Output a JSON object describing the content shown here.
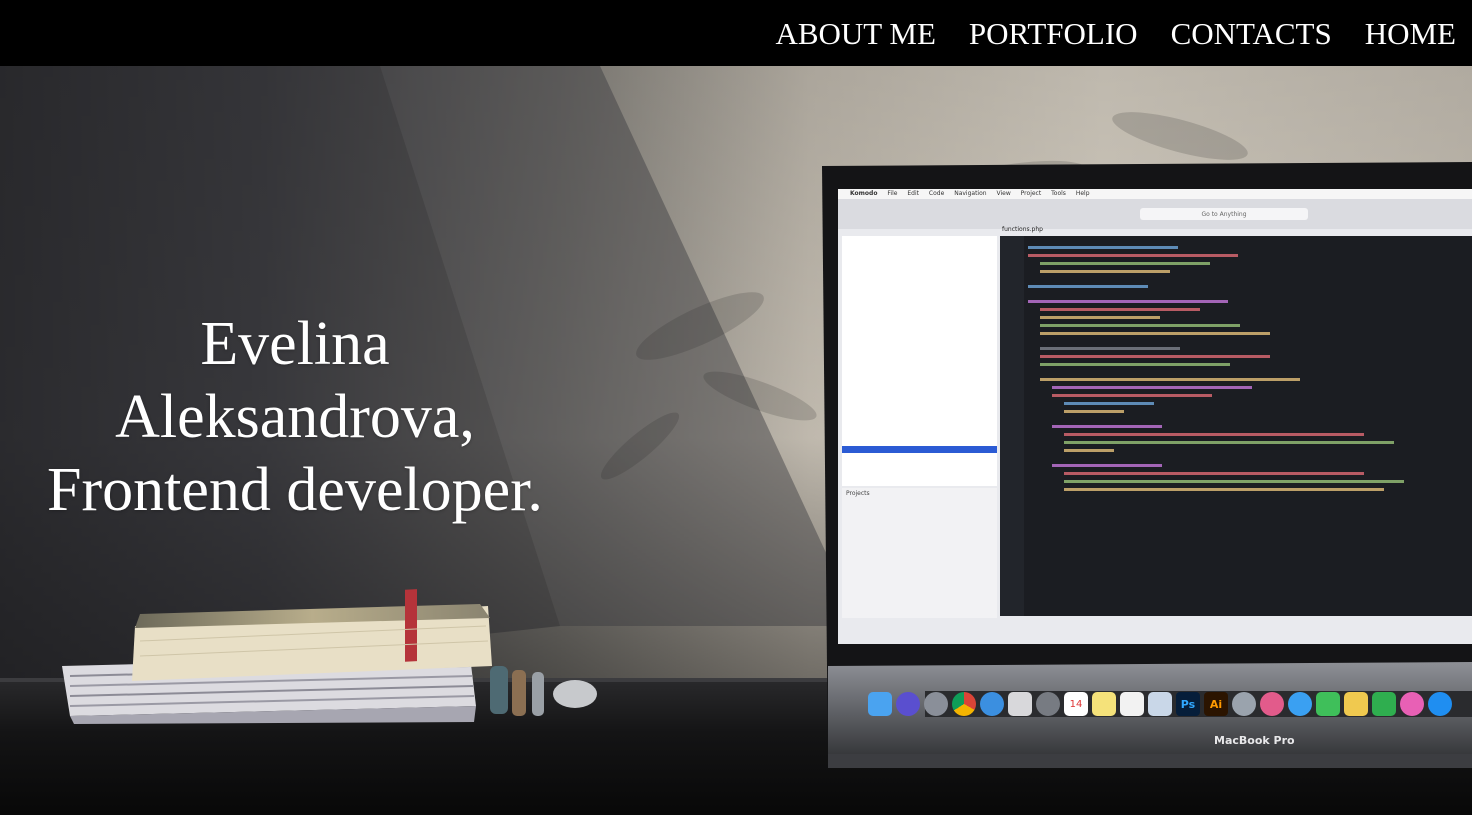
{
  "nav": {
    "items": [
      {
        "label": "ABOUT ME"
      },
      {
        "label": "PORTFOLIO"
      },
      {
        "label": "CONTACTS"
      },
      {
        "label": "HOME"
      }
    ]
  },
  "hero": {
    "title_lines": [
      "Evelina",
      "Aleksandrova,",
      "Frontend developer."
    ]
  },
  "laptop": {
    "brand_label": "MacBook Pro",
    "editor_menu": [
      "Komodo",
      "File",
      "Edit",
      "Code",
      "Navigation",
      "View",
      "Project",
      "Tools",
      "Help"
    ],
    "search_placeholder": "Go to Anything",
    "tab_label": "functions.php",
    "projects_label": "Projects",
    "dock_badge_ps": "Ps",
    "dock_badge_ai": "Ai",
    "dock_badge_cal": "14"
  },
  "colors": {
    "nav_bg": "#000000",
    "nav_text": "#ffffff",
    "hero_text": "#ffffff",
    "wall_light": "#d9d2c6",
    "wall_dark": "#3b3b3e",
    "desk": "#1c1c1e",
    "editor_bg": "#1b1d22",
    "highlight": "#2b5bd4"
  }
}
